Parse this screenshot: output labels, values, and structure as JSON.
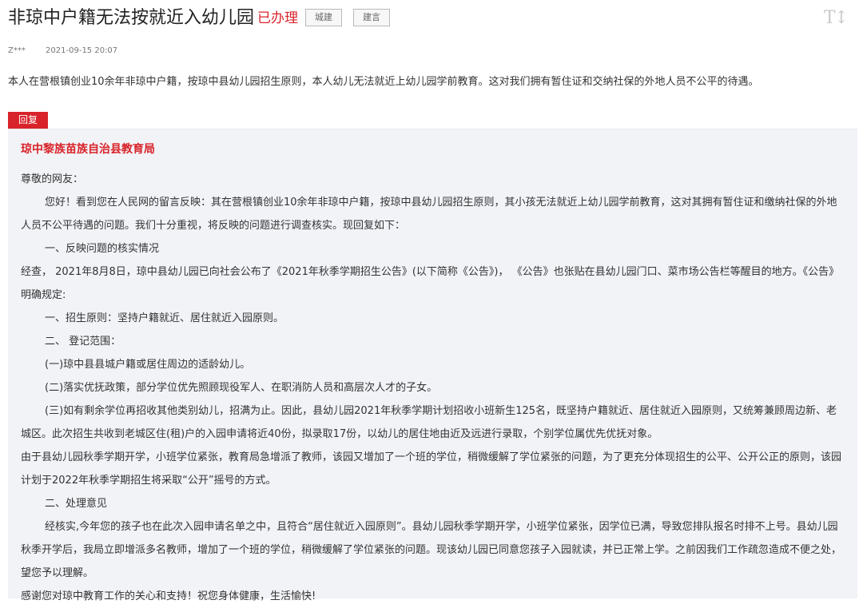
{
  "header": {
    "title": "非琼中户籍无法按就近入幼儿园",
    "status": "已办理",
    "tags": [
      "城建",
      "建言"
    ],
    "font_size_toggle": "T↕"
  },
  "meta": {
    "author": "Z***",
    "date": "2021-09-15 20:07"
  },
  "question": "本人在营根镇创业10余年非琼中户籍，按琼中县幼儿园招生原则，本人幼儿无法就近上幼儿园学前教育。这对我们拥有暂住证和交纳社保的外地人员不公平的待遇。",
  "reply": {
    "tab_label": "回复",
    "org": "琼中黎族苗族自治县教育局",
    "paragraphs": [
      "尊敬的网友：",
      "您好！看到您在人民网的留言反映：其在营根镇创业10余年非琼中户籍，按琼中县幼儿园招生原则，其小孩无法就近上幼儿园学前教育，这对其拥有暂住证和缴纳社保的外地人员不公平待遇的问题。我们十分重视，将反映的问题进行调查核实。现回复如下：",
      "一、反映问题的核实情况",
      "经查， 2021年8月8日，琼中县幼儿园已向社会公布了《2021年秋季学期招生公告》(以下简称《公告》)， 《公告》也张贴在县幼儿园门口、菜市场公告栏等醒目的地方。《公告》明确规定:",
      "一、招生原则：坚持户籍就近、居住就近入园原则。",
      "二、 登记范围：",
      "(一)琼中县县城户籍或居住周边的适龄幼儿。",
      "(二)落实优抚政策，部分学位优先照顾现役军人、在职消防人员和高层次人才的子女。",
      "(三)如有剩余学位再招收其他类别幼儿，招满为止。因此，县幼儿园2021年秋季学期计划招收小班新生125名，既坚持户籍就近、居住就近入园原则，又统筹兼顾周边新、老城区。此次招生共收到老城区住(租)户的入园申请将近40份，拟录取17份，以幼儿的居住地由近及远进行录取，个别学位属优先优抚对象。",
      "由于县幼儿园秋季学期开学，小班学位紧张，教育局急增派了教师，该园又增加了一个班的学位，稍微缓解了学位紧张的问题，为了更充分体现招生的公平、公开公正的原则，该园计划于2022年秋季学期招生将采取“公开”摇号的方式。",
      "二、处理意见",
      "经核实,今年您的孩子也在此次入园申请名单之中，且符合“居住就近入园原则”。县幼儿园秋季学期开学，小班学位紧张，因学位已满，导致您排队报名时排不上号。县幼儿园秋季开学后，我局立即增派多名教师，增加了一个班的学位，稍微缓解了学位紧张的问题。现该幼儿园已同意您孩子入园就读，并已正常上学。之前因我们工作疏忽造成不便之处，望您予以理解。",
      "感谢您对琼中教育工作的关心和支持！祝您身体健康，生活愉快!"
    ]
  }
}
